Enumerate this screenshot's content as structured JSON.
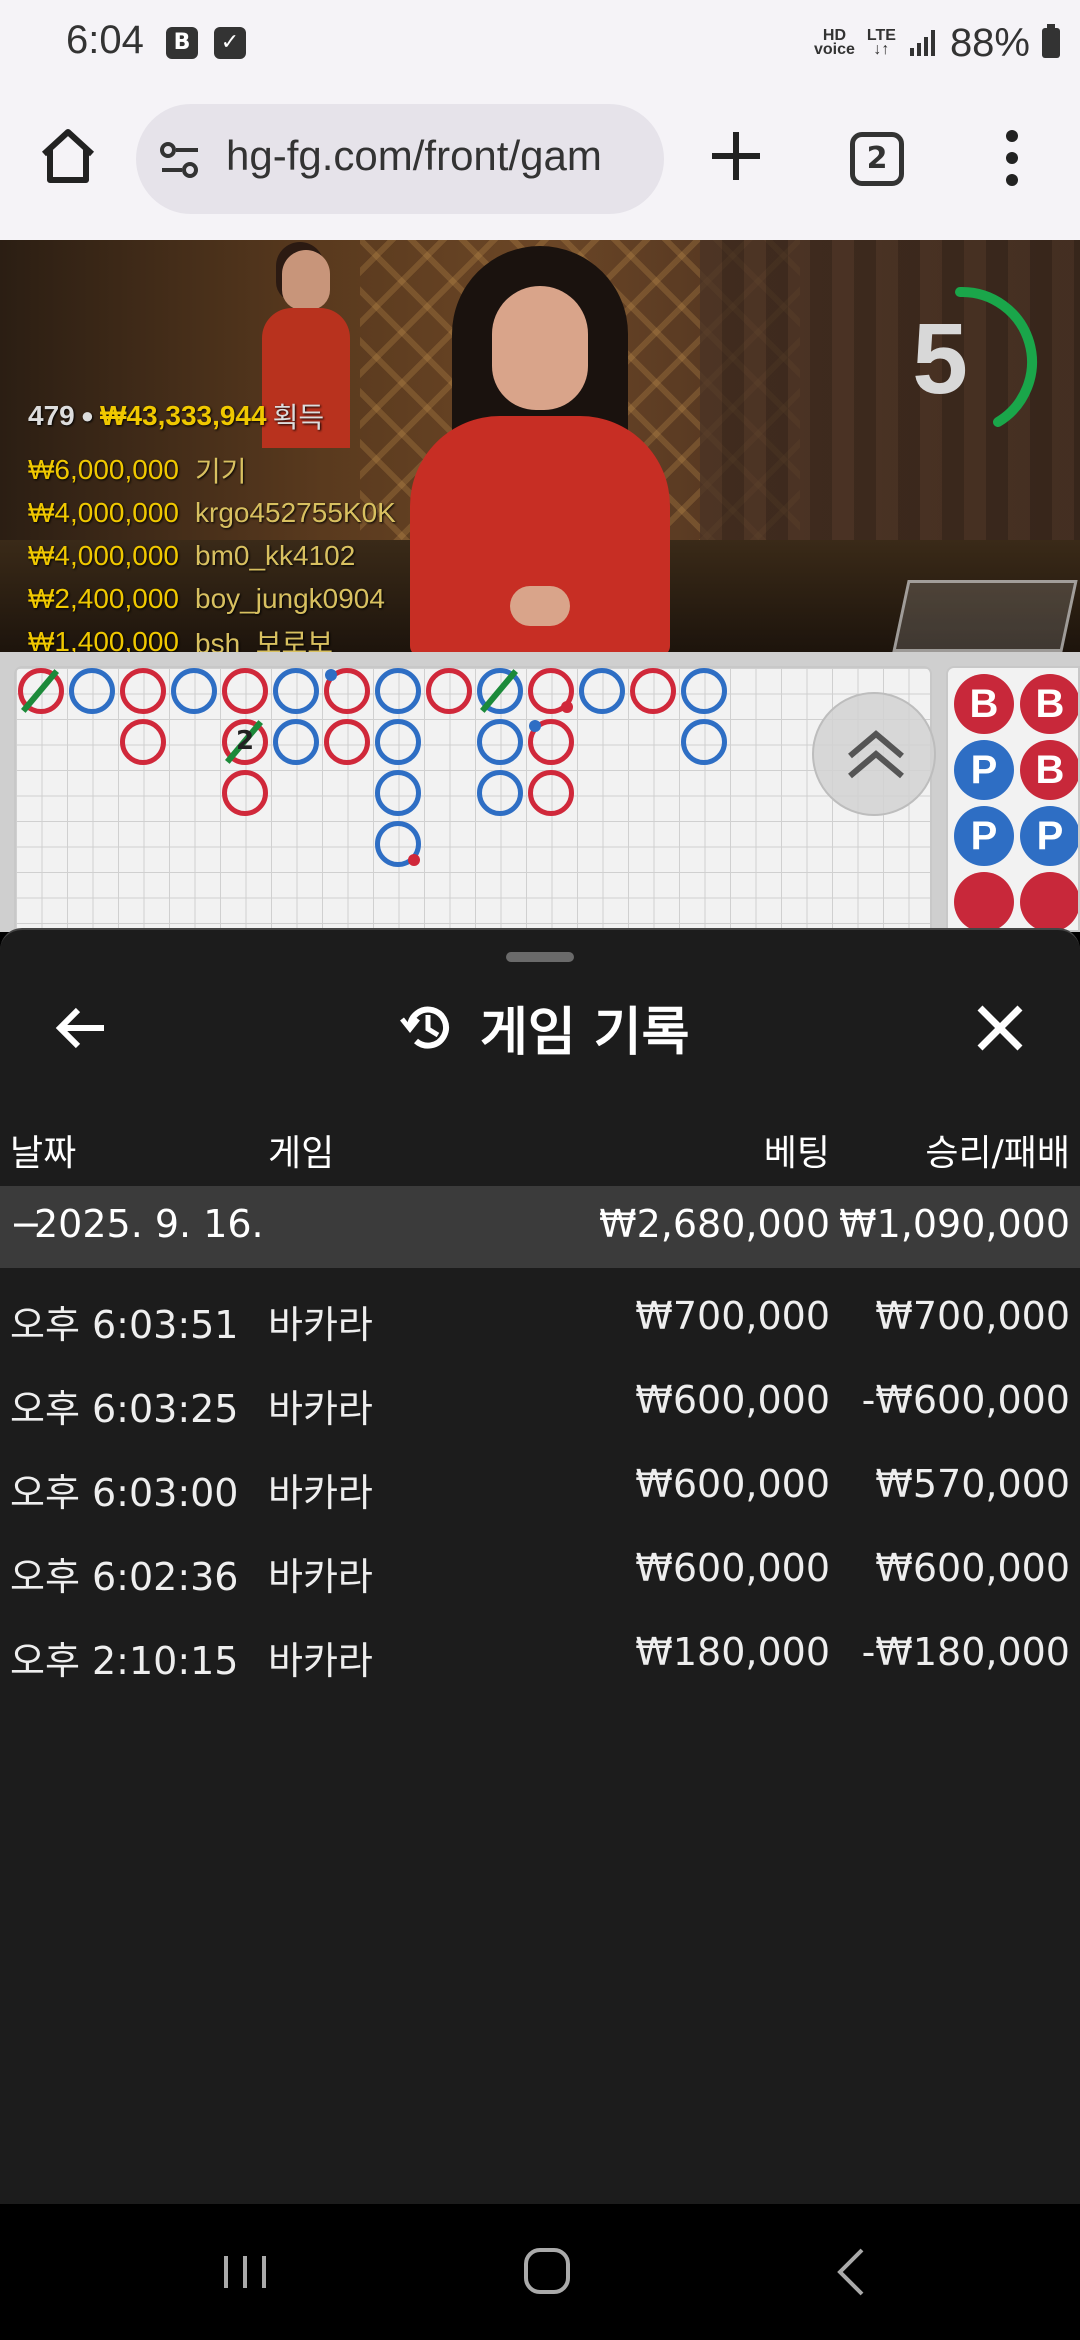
{
  "status_bar": {
    "time": "6:04",
    "icon_b": "B",
    "hd_voice": "HD\nvoice",
    "lte": "LTE",
    "battery": "88%"
  },
  "browser": {
    "url": "hg-fg.com/front/gam",
    "tab_count": "2"
  },
  "video": {
    "viewer_count": "479",
    "total_amount": "₩43,333,944",
    "total_label": "획득",
    "winners": [
      {
        "amount": "₩6,000,000",
        "user": "기기"
      },
      {
        "amount": "₩4,000,000",
        "user": "krgo452755K0K"
      },
      {
        "amount": "₩4,000,000",
        "user": "bm0_kk4102"
      },
      {
        "amount": "₩2,400,000",
        "user": "boy_jungk0904"
      },
      {
        "amount": "₩1,400,000",
        "user": "bsh_보로보"
      }
    ],
    "countdown": "5",
    "countdown_color": "#1aa64a"
  },
  "roadmap": {
    "colors": {
      "banker": "#d0283a",
      "player": "#2e6ec4",
      "tie": "#1c8a3a"
    },
    "tie_count": "2",
    "side_labels": [
      "B",
      "B",
      "P",
      "B",
      "P",
      "P"
    ]
  },
  "sheet": {
    "title": "게임 기록",
    "columns": {
      "date": "날짜",
      "game": "게임",
      "bet": "베팅",
      "result": "승리/패배"
    },
    "date_group": {
      "date": "2025. 9. 16.",
      "bet": "₩2,680,000",
      "result": "₩1,090,000"
    },
    "rows": [
      {
        "time": "오후 6:03:51",
        "game": "바카라",
        "bet": "₩700,000",
        "result": "₩700,000"
      },
      {
        "time": "오후 6:03:25",
        "game": "바카라",
        "bet": "₩600,000",
        "result": "-₩600,000"
      },
      {
        "time": "오후 6:03:00",
        "game": "바카라",
        "bet": "₩600,000",
        "result": "₩570,000"
      },
      {
        "time": "오후 6:02:36",
        "game": "바카라",
        "bet": "₩600,000",
        "result": "₩600,000"
      },
      {
        "time": "오후 2:10:15",
        "game": "바카라",
        "bet": "₩180,000",
        "result": "-₩180,000"
      }
    ]
  }
}
